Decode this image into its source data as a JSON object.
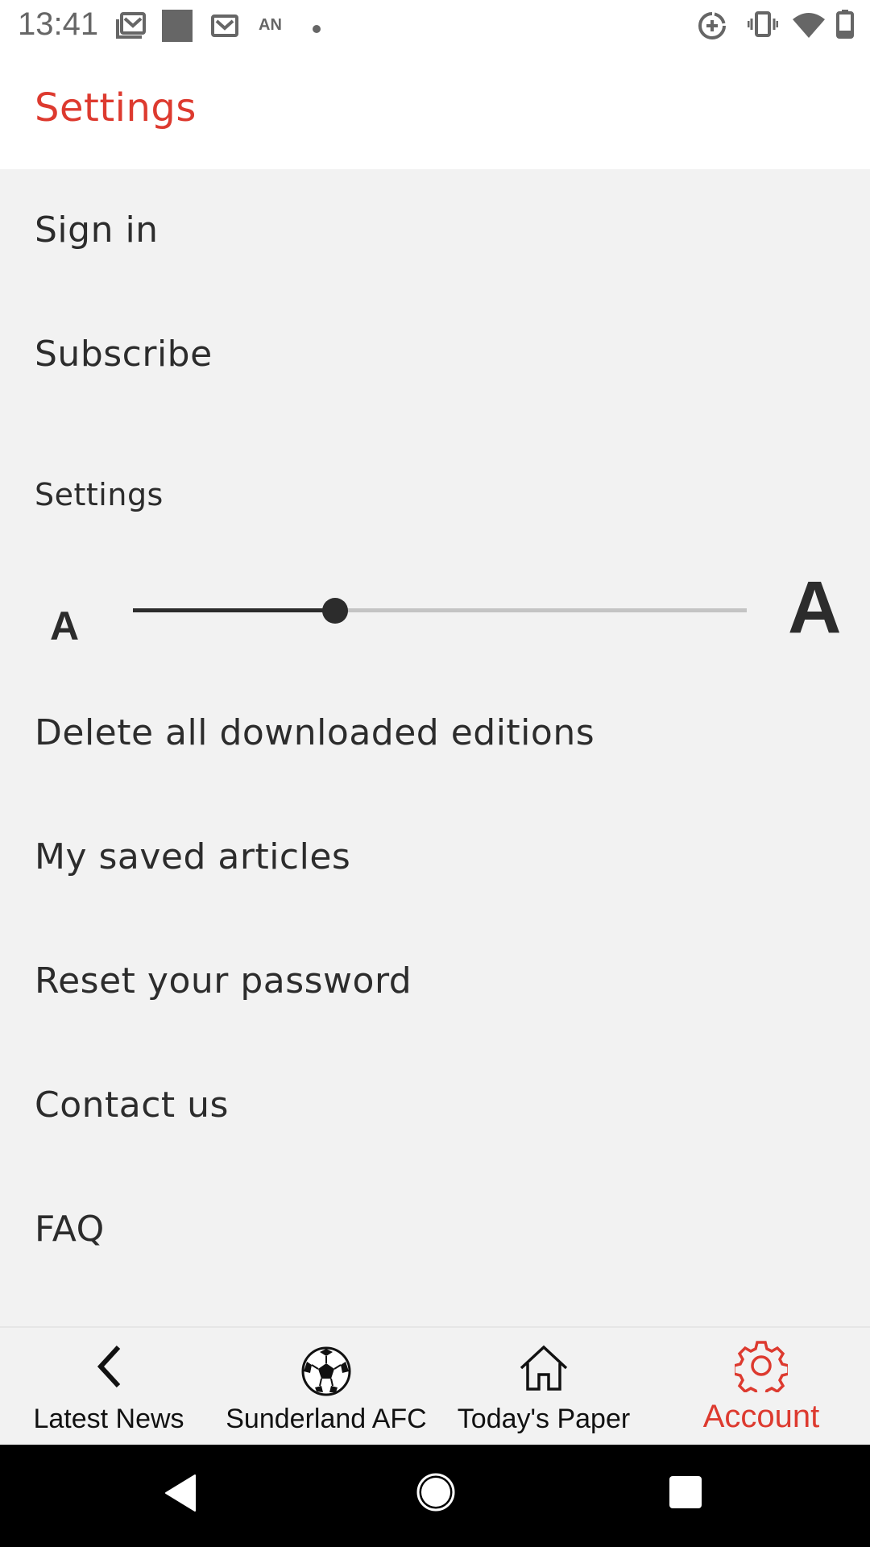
{
  "status_bar": {
    "time": "13:41",
    "left_icons": [
      "gmail-stack-icon",
      "notification-square-icon",
      "gmail-icon",
      "an-text-icon",
      "dot-icon"
    ],
    "an_label": "AN",
    "right_icons": [
      "data-saver-icon",
      "vibrate-icon",
      "wifi-icon",
      "battery-icon"
    ]
  },
  "header": {
    "title": "Settings"
  },
  "menu": {
    "sign_in": "Sign in",
    "subscribe": "Subscribe",
    "settings_section": "Settings",
    "text_size": {
      "small_label": "A",
      "large_label": "A",
      "value_fraction": 0.33
    },
    "delete_downloads": "Delete all downloaded editions",
    "saved_articles": "My saved articles",
    "reset_password": "Reset your password",
    "contact_us": "Contact us",
    "faq": "FAQ"
  },
  "bottom_nav": {
    "tabs": [
      {
        "label": "Latest News",
        "icon": "chevron-left-icon",
        "active": false
      },
      {
        "label": "Sunderland AFC",
        "icon": "football-icon",
        "active": false
      },
      {
        "label": "Today's Paper",
        "icon": "home-icon",
        "active": false
      },
      {
        "label": "Account",
        "icon": "gear-icon",
        "active": true
      }
    ]
  },
  "colors": {
    "accent": "#dd3a2f",
    "text": "#2c2c2c",
    "background": "#f2f2f2",
    "header_bg": "#ffffff"
  },
  "system_nav": {
    "buttons": [
      "back-icon",
      "home-circle-icon",
      "recents-icon"
    ]
  }
}
